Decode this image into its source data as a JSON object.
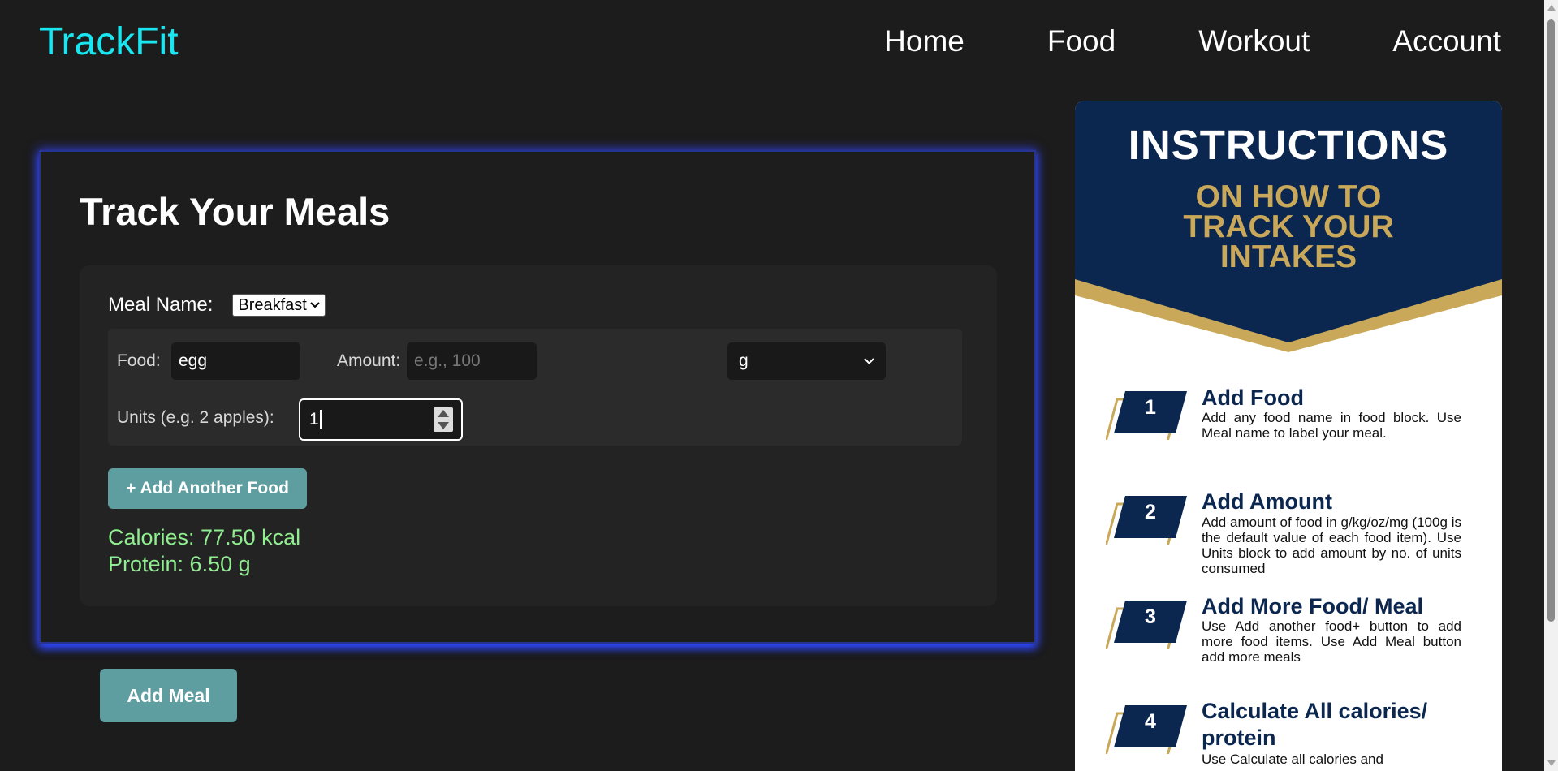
{
  "nav": {
    "brand": "TrackFit",
    "items": [
      {
        "label": "Home"
      },
      {
        "label": "Food"
      },
      {
        "label": "Workout"
      },
      {
        "label": "Account"
      }
    ]
  },
  "tracker": {
    "title": "Track Your Meals",
    "meal_name_label": "Meal Name:",
    "meal_name_value": "Breakfast",
    "food_label": "Food:",
    "food_value": "egg",
    "amount_label": "Amount:",
    "amount_placeholder": "e.g., 100",
    "unit_value": "g",
    "units_label": "Units (e.g. 2 apples):",
    "units_value": "1",
    "add_food_button": "+ Add Another Food",
    "calories": "Calories: 77.50 kcal",
    "protein": "Protein: 6.50 g",
    "add_meal_button": "Add Meal"
  },
  "instructions": {
    "title": "INSTRUCTIONS",
    "subtitle_line1": "ON HOW TO",
    "subtitle_line2": "TRACK YOUR",
    "subtitle_line3": "INTAKES",
    "steps": [
      {
        "num": "1",
        "heading": "Add Food",
        "body": "Add any food name in food block. Use Meal name to label your meal."
      },
      {
        "num": "2",
        "heading": "Add Amount",
        "body": "Add amount of food in g/kg/oz/mg (100g is the default value of each food item). Use Units block to add amount by no. of units consumed"
      },
      {
        "num": "3",
        "heading": "Add More Food/ Meal",
        "body": "Use Add another food+ button to add more food items. Use Add Meal button add more meals"
      },
      {
        "num": "4",
        "heading": "Calculate All calories/ protein",
        "body": "Use Calculate all calories and"
      }
    ],
    "colors": {
      "navy": "#0b2750",
      "gold": "#c9a85a"
    }
  }
}
